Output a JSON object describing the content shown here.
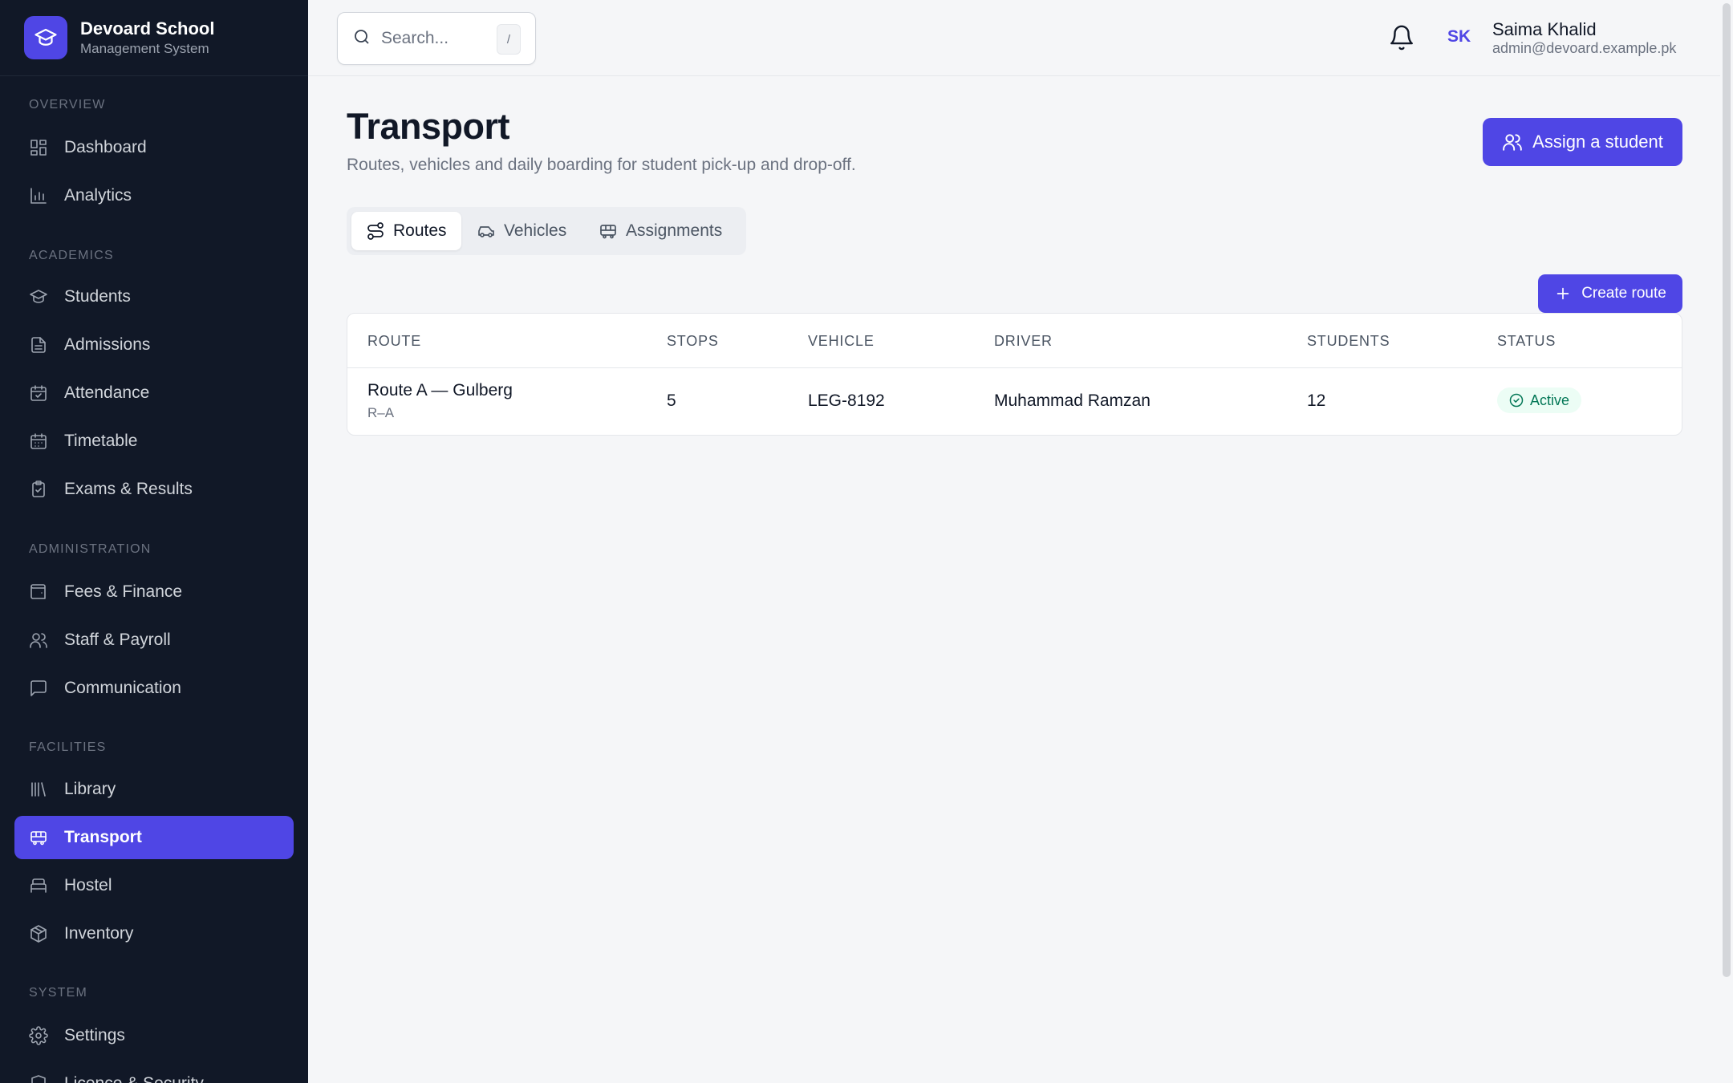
{
  "brand": {
    "name": "Devoard School",
    "subtitle": "Management System"
  },
  "sidebar": {
    "sections": [
      {
        "label": "OVERVIEW"
      },
      {
        "label": "ACADEMICS"
      },
      {
        "label": "ADMINISTRATION"
      },
      {
        "label": "FACILITIES"
      },
      {
        "label": "SYSTEM"
      }
    ],
    "items": [
      {
        "label": "Dashboard",
        "icon": "grid-icon"
      },
      {
        "label": "Analytics",
        "icon": "bar-chart-icon"
      },
      {
        "label": "Students",
        "icon": "graduation-cap-icon"
      },
      {
        "label": "Admissions",
        "icon": "file-text-icon"
      },
      {
        "label": "Attendance",
        "icon": "calendar-check-icon"
      },
      {
        "label": "Timetable",
        "icon": "calendar-icon"
      },
      {
        "label": "Exams & Results",
        "icon": "clipboard-check-icon"
      },
      {
        "label": "Fees & Finance",
        "icon": "wallet-icon"
      },
      {
        "label": "Staff & Payroll",
        "icon": "users-icon"
      },
      {
        "label": "Communication",
        "icon": "message-square-icon"
      },
      {
        "label": "Library",
        "icon": "library-icon"
      },
      {
        "label": "Transport",
        "icon": "bus-icon",
        "active": true
      },
      {
        "label": "Hostel",
        "icon": "bed-icon"
      },
      {
        "label": "Inventory",
        "icon": "package-icon"
      },
      {
        "label": "Settings",
        "icon": "gear-icon"
      },
      {
        "label": "Licence & Security",
        "icon": "shield-icon"
      }
    ]
  },
  "header": {
    "search_placeholder": "Search...",
    "search_shortcut": "/",
    "user": {
      "initials": "SK",
      "name": "Saima Khalid",
      "email": "admin@devoard.example.pk"
    }
  },
  "page": {
    "title": "Transport",
    "subtitle": "Routes, vehicles and daily boarding for student pick-up and drop-off.",
    "assign_label": "Assign a student",
    "create_label": "Create route"
  },
  "tabs": [
    {
      "label": "Routes",
      "icon": "route-icon",
      "active": true
    },
    {
      "label": "Vehicles",
      "icon": "car-icon"
    },
    {
      "label": "Assignments",
      "icon": "bus-icon"
    }
  ],
  "table": {
    "columns": [
      "ROUTE",
      "STOPS",
      "VEHICLE",
      "DRIVER",
      "STUDENTS",
      "STATUS"
    ],
    "rows": [
      {
        "route": "Route A — Gulberg",
        "code": "R–A",
        "stops": "5",
        "vehicle": "LEG-8192",
        "driver": "Muhammad Ramzan",
        "students": "12",
        "status": "Active"
      }
    ]
  },
  "colors": {
    "accent": "#4f46e5",
    "sidebar_bg": "#111827",
    "status_active_bg": "#ecfdf5",
    "status_active_fg": "#047857"
  }
}
